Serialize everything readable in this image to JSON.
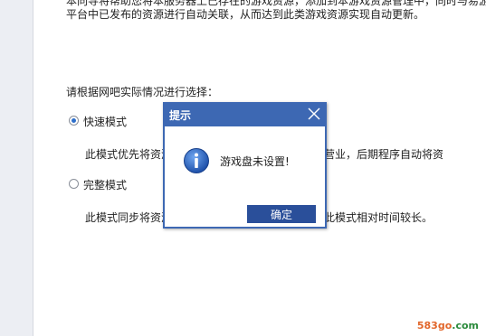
{
  "intro": {
    "line1": "本向导将帮助您将本服务器上已存在的游戏资源，添加到本游戏资源管理中，同时与易游",
    "line2": "平台中已发布的资源进行自动关联，从而达到此类游戏资源实现自动更新。"
  },
  "prompt": "请根据网吧实际情况进行选择：",
  "options": [
    {
      "label": "快速模式",
      "checked": true,
      "desc": "此模式优先将资源建立到网吧中，以实现网吧快速营业，后期程序自动将资"
    },
    {
      "label": "完整模式",
      "checked": false,
      "desc": "此模式同步将资源与易游平台进行全部关联云端，此模式相对时间较长。"
    }
  ],
  "dialog": {
    "title": "提示",
    "message": "游戏盘未设置!",
    "ok_label": "确定",
    "icon": "info-icon",
    "close_icon": "close-icon"
  },
  "watermark": {
    "part1": "583go",
    "part2": ".com"
  },
  "colors": {
    "accent": "#3d68b3",
    "button": "#2a4f9a",
    "radio": "#2e6fcb"
  }
}
